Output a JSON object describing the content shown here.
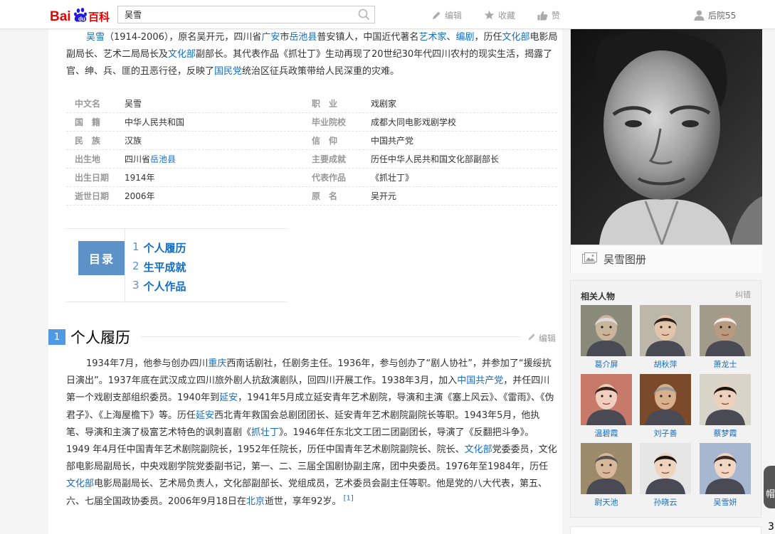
{
  "topbar": {
    "logo_text": "Baidu百科",
    "search_value": "吴雪",
    "edit_label": "编辑",
    "favorite_label": "收藏",
    "like_label": "赞",
    "user_label": "后院55"
  },
  "summary": {
    "segments": [
      {
        "t": "吴雪",
        "link": true
      },
      {
        "t": "（1914-2006），原名吴开元，四川省",
        "link": false
      },
      {
        "t": "广安",
        "link": true
      },
      {
        "t": "市",
        "link": false
      },
      {
        "t": "岳池县",
        "link": true
      },
      {
        "t": "普安镇人，中国近代著名",
        "link": false
      },
      {
        "t": "艺术家",
        "link": true
      },
      {
        "t": "、",
        "link": false
      },
      {
        "t": "编剧",
        "link": true
      },
      {
        "t": "，历任",
        "link": false
      },
      {
        "t": "文化部",
        "link": true
      },
      {
        "t": "电影局副局长、艺术二局局长及",
        "link": false
      },
      {
        "t": "文化部",
        "link": true
      },
      {
        "t": "副部长。其代表作品《抓壮丁》生动再现了20世纪30年代四川农村的现实生活，揭露了官、绅、兵、匪的丑恶行径，反映了",
        "link": false
      },
      {
        "t": "国民党",
        "link": true
      },
      {
        "t": "统治区征兵政策带给人民深重的灾难。",
        "link": false
      }
    ]
  },
  "infobox": {
    "rows": [
      {
        "k1": "中文名",
        "v1": "吴雪",
        "v1_link": "",
        "k2": "职　业",
        "v2": "戏剧家"
      },
      {
        "k1": "国　籍",
        "v1": "中华人民共和国",
        "v1_link": "",
        "k2": "毕业院校",
        "v2": "成都大同电影戏剧学校"
      },
      {
        "k1": "民　族",
        "v1": "汉族",
        "v1_link": "",
        "k2": "信　仰",
        "v2": "中国共产党"
      },
      {
        "k1": "出生地",
        "v1": "四川省",
        "v1_link": "岳池县",
        "k2": "主要成就",
        "v2": "历任中华人民共和国文化部副部长"
      },
      {
        "k1": "出生日期",
        "v1": "1914年",
        "v1_link": "",
        "k2": "代表作品",
        "v2": "《抓壮丁》"
      },
      {
        "k1": "逝世日期",
        "v1": "2006年",
        "v1_link": "",
        "k2": "原　名",
        "v2": "吴开元"
      }
    ]
  },
  "catalog": {
    "label": "目录",
    "items": [
      {
        "num": "1",
        "text": "个人履历"
      },
      {
        "num": "2",
        "text": "生平成就"
      },
      {
        "num": "3",
        "text": "个人作品"
      }
    ]
  },
  "section1": {
    "num": "1",
    "title": "个人履历",
    "edit_label": "编辑",
    "segments": [
      {
        "t": "1934年7月，他参与创办四川",
        "link": false
      },
      {
        "t": "重庆",
        "link": true
      },
      {
        "t": "西南话剧社，任剧务主任。1936年，参与创办了“剧人协社”，并参加了“援绥抗日演出”。1937年底在武汉成立四川旅外剧人抗敌演剧队，回四川开展工作。1938年3月，加入",
        "link": false
      },
      {
        "t": "中国共产党",
        "link": true
      },
      {
        "t": "，并任四川第一个戏剧支部组织委员。1940年到",
        "link": false
      },
      {
        "t": "延安",
        "link": true
      },
      {
        "t": "，1941年5月成立延安青年艺术剧院，导演和主演《塞上风云》、《雷雨》、《伪君子》、《上海屋檐下》等。历任",
        "link": false
      },
      {
        "t": "延安",
        "link": true
      },
      {
        "t": "西北青年救国会总剧团团长、延安青年艺术剧院副院长等职。1943年5月，他执笔、导演和主演了极富艺术特色的讽刺喜剧《",
        "link": false
      },
      {
        "t": "抓壮丁",
        "link": true
      },
      {
        "t": "》。1946年任东北文工团二团副团长，导演了《反翻把斗争》。1949 年4月任中国青年艺术剧院副院长，1952年任院长，历任中国青年艺术剧院副院长、院长、",
        "link": false
      },
      {
        "t": "文化部",
        "link": true
      },
      {
        "t": "党委委员，文化部电影局副局长，中央戏剧学院党委副书记，第一、二、三届全国剧协副主席，团中央委员。1976年至1984年，历任",
        "link": false
      },
      {
        "t": "文化部",
        "link": true
      },
      {
        "t": "电影局副局长、艺术局负责人，文化部副部长、党组成员，艺术委员会副主任等职。他是党的八大代表，第五、六、七届全国政协委员。2006年9月18日在",
        "link": false
      },
      {
        "t": "北京",
        "link": true
      },
      {
        "t": "逝世，享年92岁。",
        "link": false
      }
    ],
    "ref": "[1]"
  },
  "album": {
    "label": "吴雪图册"
  },
  "related": {
    "title": "相关人物",
    "error_label": "纠错",
    "people": [
      {
        "name": "葛介屏"
      },
      {
        "name": "胡秋萍"
      },
      {
        "name": "萧龙士"
      },
      {
        "name": "温碧霞"
      },
      {
        "name": "刘子善"
      },
      {
        "name": "蔡梦霞"
      },
      {
        "name": "尉天池"
      },
      {
        "name": "孙晓云"
      },
      {
        "name": "吴雪妍"
      }
    ]
  },
  "edge": {
    "tip": "帽",
    "num": "3"
  },
  "colors": {
    "link": "#136ec2",
    "catalog": "#5d92c8",
    "section_num": "#4f9ae2",
    "logo_red": "#e10602",
    "logo_blue": "#2319dc"
  }
}
